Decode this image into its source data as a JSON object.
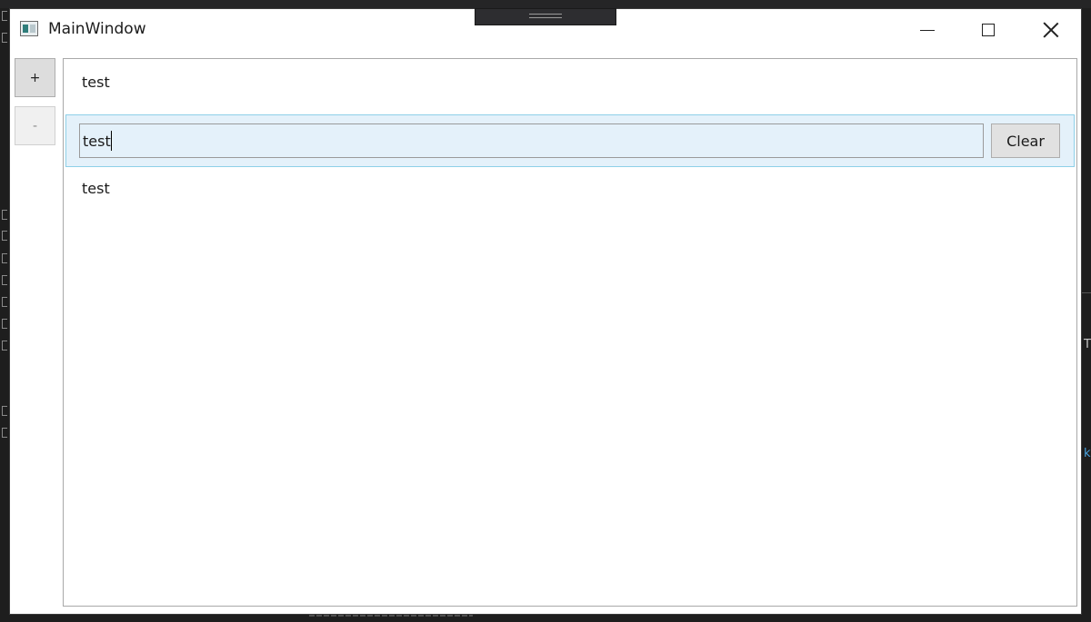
{
  "window": {
    "title": "MainWindow",
    "icon": "app-window-icon",
    "caption_icons": [
      "minimize-icon",
      "maximize-icon",
      "close-icon"
    ]
  },
  "side_buttons": {
    "add_label": "+",
    "remove_label": "-"
  },
  "list": {
    "items": [
      {
        "text": "test"
      },
      {
        "value": "test",
        "button_label": "Clear",
        "selected": true
      },
      {
        "text": "test"
      }
    ]
  },
  "ide_background": {
    "right_glyph_1": "T",
    "right_glyph_2": "k"
  },
  "colors": {
    "selection_background": "#e4f1fa",
    "selection_border": "#8ed0e8",
    "desktop_background": "#1e1e1e"
  }
}
